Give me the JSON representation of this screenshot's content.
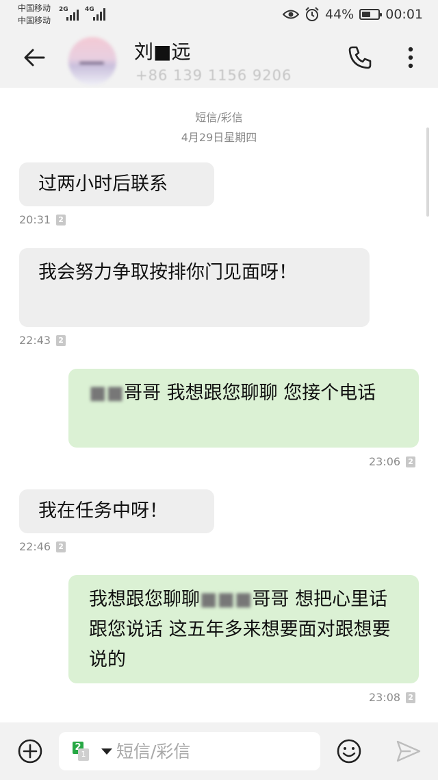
{
  "status_bar": {
    "carrier_1": "中国移动",
    "carrier_2": "中国移动",
    "network_1": "2G",
    "network_2": "4G",
    "battery": "44%",
    "time": "00:01",
    "icons": [
      "eye-icon",
      "alarm-icon",
      "battery-icon"
    ]
  },
  "header": {
    "contact_name": "刘■远",
    "contact_number": "+86 139 1156 9206",
    "icons": [
      "back-arrow-icon",
      "phone-icon",
      "more-vertical-icon"
    ]
  },
  "thread": {
    "channel_label": "短信/彩信",
    "date_label": "4月29日星期四",
    "messages": [
      {
        "direction": "in",
        "text": "过两小时后联系",
        "time": "20:31",
        "sim": "2"
      },
      {
        "direction": "in",
        "text": "我会努力争取按排你门见面呀！",
        "time": "22:43",
        "sim": "2"
      },
      {
        "direction": "out",
        "text_redacted": "■■",
        "text": "哥哥  我想跟您聊聊  您接个电话",
        "time": "23:06",
        "sim": "2"
      },
      {
        "direction": "in",
        "text": "我在任务中呀！",
        "time": "22:46",
        "sim": "2"
      },
      {
        "direction": "out",
        "text_pre": "我想跟您聊聊",
        "text_redacted": "■■■",
        "text_post": "哥哥   想把心里话跟您说话  这五年多来想要面对跟想要说的",
        "time": "23:08",
        "sim": "2"
      }
    ]
  },
  "composer": {
    "placeholder": "短信/彩信",
    "active_sim": "2",
    "inactive_sim": "1",
    "icons": [
      "add-circle-icon",
      "sim-switch-icon",
      "emoji-icon",
      "send-icon"
    ]
  },
  "colors": {
    "incoming_bubble": "#eeeeee",
    "outgoing_bubble": "#dbf1d4",
    "bar_background": "#f2f2f2",
    "sim_green": "#27a844"
  }
}
